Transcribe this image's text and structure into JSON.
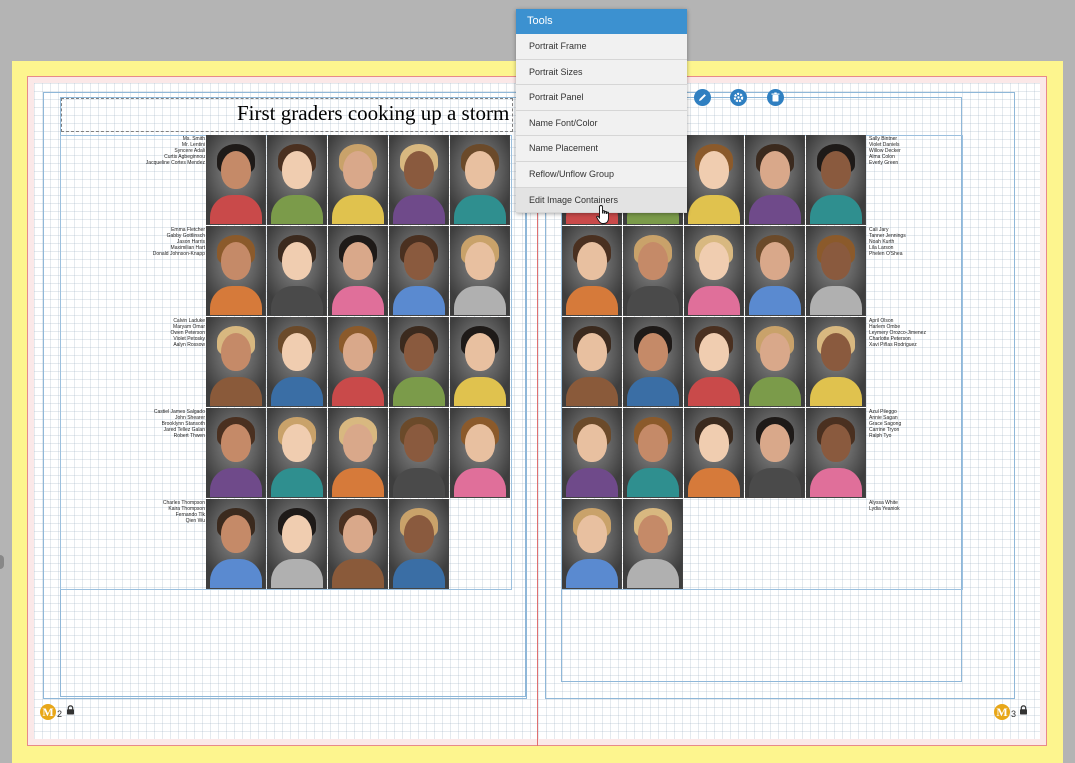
{
  "tools_menu": {
    "title": "Tools",
    "items": [
      "Portrait Frame",
      "Portrait Sizes",
      "Portrait Panel",
      "Name Font/Color",
      "Name Placement",
      "Reflow/Unflow Group",
      "Edit Image Containers"
    ],
    "hovered_item": "Edit Image Containers"
  },
  "element_toolbar": {
    "icons": [
      "pencil-icon",
      "gear-icon",
      "trash-icon"
    ],
    "accent_color": "#2f7fc1"
  },
  "title": {
    "text": "First graders cooking up a storm"
  },
  "left_page": {
    "page_number": "2",
    "rows": [
      [
        "Ms. Smith",
        "Mr. Lentini",
        "Syncere Adali",
        "Curtis Agbeginnou",
        "Jacqueline Cortes Mendez"
      ],
      [
        "Emma Fletcher",
        "Gabby Gottlinsch",
        "Jason Harris",
        "Maximilian Hart",
        "Donald Johnson-Knapp"
      ],
      [
        "Calvin Laduke",
        "Maryam Omar",
        "Owen Peterson",
        "Violet Petosky",
        "Aalyn Rossow"
      ],
      [
        "Castiel James Salgado",
        "John Shearer",
        "Brooklynn Stansoth",
        "Jared Tellez Galan",
        "Robert Thwen"
      ],
      [
        "Charles Thompson",
        "Kaira Thompson",
        "Fernando Tlk",
        "Qien Wu"
      ]
    ]
  },
  "right_page": {
    "page_number": "3",
    "rows": [
      [
        "Sally Bintner",
        "Violet Daniels",
        "Willow Decker",
        "Alma Colon",
        "Everly Green"
      ],
      [
        "Cali Jary",
        "Tanner Jennings",
        "Noah Kurth",
        "Lila Larson",
        "Phelen O'Shea"
      ],
      [
        "April Olson",
        "Harlem Ombe",
        "Leymery Orozco-Jimenez",
        "Charlotte Peterson",
        "Xavi Piñas Rodriguez"
      ],
      [
        "Azul Pileggo",
        "Annie Sagan",
        "Grace Sagong",
        "Carrine Tryon",
        "Ralph Tyo"
      ],
      [
        "Alyssa White",
        "Lydia Yeaniok"
      ]
    ]
  },
  "colors": {
    "bleed": "#fdf58e",
    "trim": "#e88a8a",
    "guide": "#8fb7d8",
    "menu_header": "#3c91d0",
    "page_badge": "#e8a719"
  },
  "page_badge_letter": "M"
}
